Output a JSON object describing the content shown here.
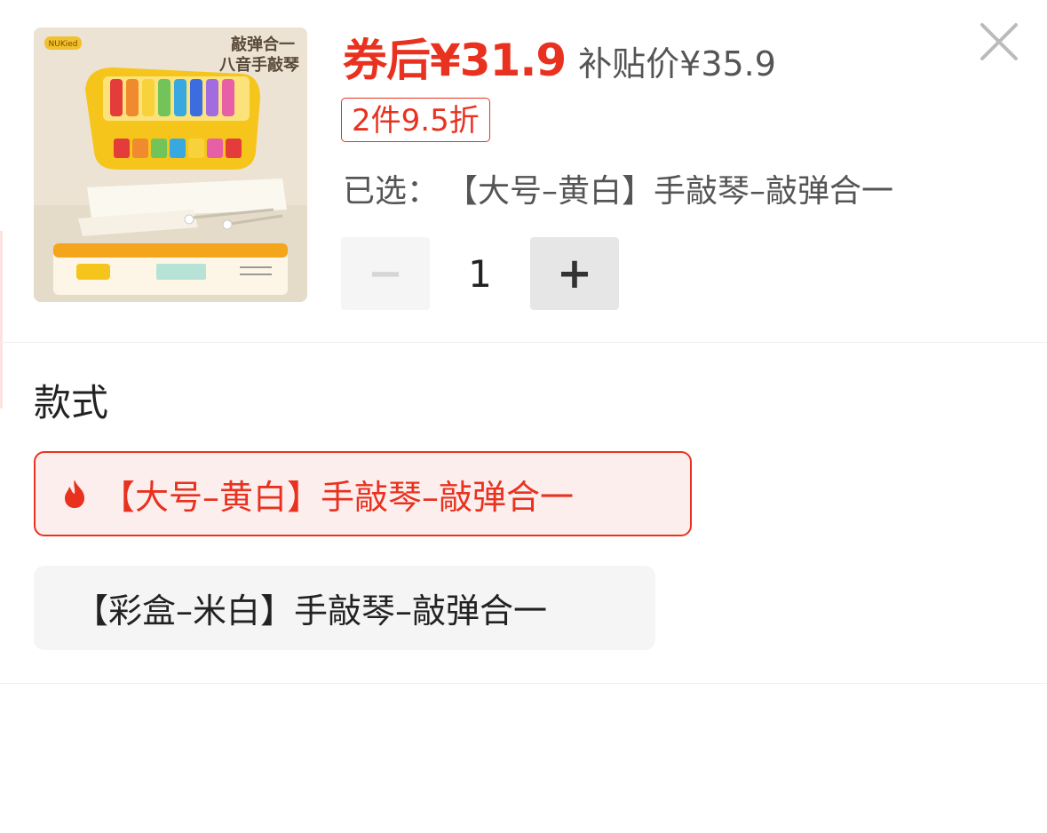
{
  "product": {
    "image_label": "product-thumbnail",
    "image_texts": {
      "brand": "NUKied",
      "headline_1": "敲弹合一",
      "headline_2": "八音手敲琴"
    },
    "price_main": "券后¥31.9",
    "price_sub": "补贴价¥35.9",
    "discount_tag": "2件9.5折",
    "selected_label": "已选：",
    "selected_value": "【大号–黄白】手敲琴–敲弹合一",
    "quantity": "1",
    "minus_label": "−",
    "plus_label": "+"
  },
  "variants": {
    "title": "款式",
    "options": [
      {
        "label": "【大号–黄白】手敲琴–敲弹合一",
        "selected": true,
        "hot_icon": "flame-icon"
      },
      {
        "label": "【彩盒–米白】手敲琴–敲弹合一",
        "selected": false
      }
    ]
  },
  "colors": {
    "accent": "#e8321f",
    "selected_bg": "#fdeeee",
    "option_bg": "#f5f5f5"
  },
  "icons": {
    "close": "close-icon"
  }
}
